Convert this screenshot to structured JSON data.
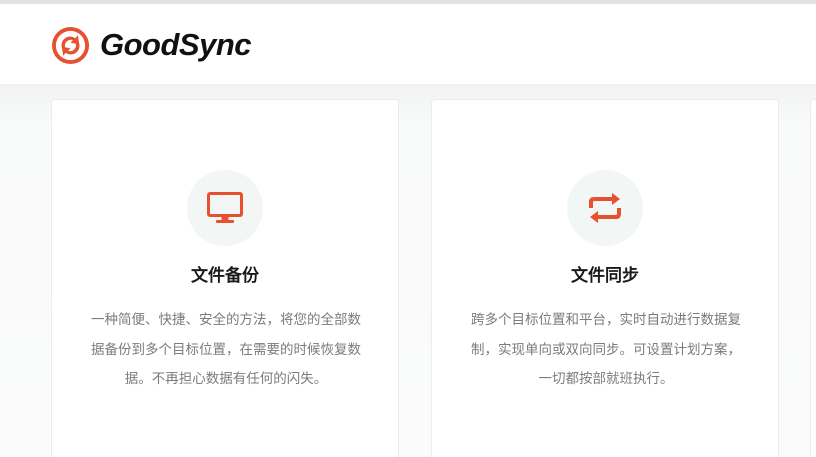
{
  "header": {
    "brand_name": "GoodSync",
    "logo_icon": "goodsync-logo-icon",
    "brand_color": "#e8512f"
  },
  "features": [
    {
      "icon": "monitor-icon",
      "title": "文件备份",
      "description": "一种简便、快捷、安全的方法，将您的全部数据备份到多个目标位置，在需要的时候恢复数据。不再担心数据有任何的闪失。"
    },
    {
      "icon": "sync-arrows-icon",
      "title": "文件同步",
      "description": "跨多个目标位置和平台，实时自动进行数据复制，实现单向或双向同步。可设置计划方案，一切都按部就班执行。"
    }
  ],
  "colors": {
    "accent": "#e8512f",
    "title_text": "#1a1a1a",
    "body_text": "#7b7b7b",
    "icon_bg": "#f2f6f5"
  }
}
